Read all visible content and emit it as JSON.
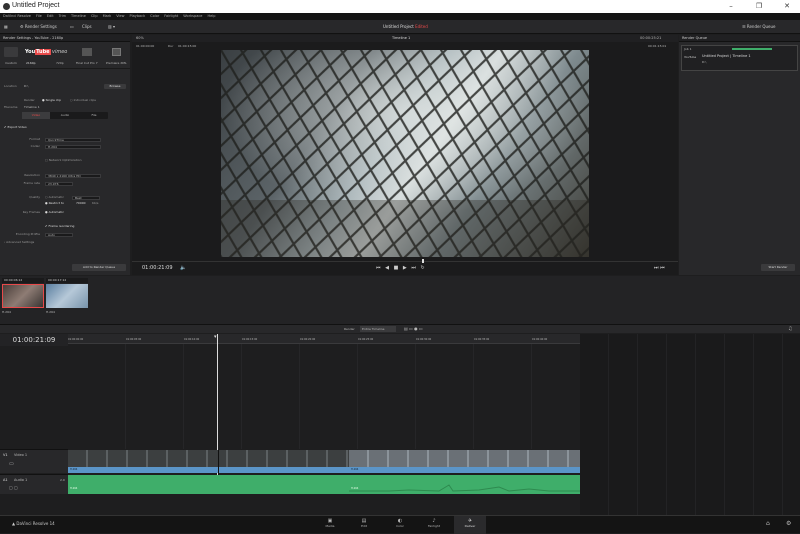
{
  "window": {
    "title": "Untitled Project"
  },
  "menu": [
    "DaVinci Resolve",
    "File",
    "Edit",
    "Trim",
    "Timeline",
    "Clip",
    "Mark",
    "View",
    "Playback",
    "Color",
    "Fairlight",
    "Workspace",
    "Help"
  ],
  "topbar": {
    "render_settings": "Render Settings",
    "clips": "Clips",
    "project_title": "Untitled Project",
    "project_status": "Edited",
    "render_queue": "Render Queue"
  },
  "left": {
    "header": "Render Settings - YouTube - 2160p",
    "presets": [
      {
        "name": "Custom"
      },
      {
        "name": "2160p"
      },
      {
        "name": "720p"
      },
      {
        "name": "Final Cut Pro 7"
      },
      {
        "name": "Premiere XML"
      }
    ],
    "filename_label": "Filename",
    "filename": "Timeline 1",
    "location_label": "Location",
    "location": "D:\\",
    "browse": "Browse",
    "render_label": "Render",
    "single_clip": "Single clip",
    "individual_clips": "Individual clips",
    "tabs": [
      "Video",
      "Audio",
      "File"
    ],
    "export_video": "Export Video",
    "format_label": "Format",
    "format": "QuickTime",
    "codec_label": "Codec",
    "codec": "H.264",
    "network_opt": "Network Optimization",
    "resolution_label": "Resolution",
    "resolution": "3840 x 2160 Ultra HD",
    "framerate_label": "Frame rate",
    "framerate": "23.976",
    "quality_label": "Quality",
    "quality_auto": "Automatic",
    "quality_best": "Best",
    "restrict_to": "Restrict to",
    "restrict_value": "70000",
    "restrict_unit": "Kb/s",
    "keyframes_label": "Key Frames",
    "kf_auto": "Automatic",
    "frame_reorder": "Frame reordering",
    "encoding_label": "Encoding Profile",
    "encoding": "Auto",
    "advanced": "Advanced Settings",
    "add_queue": "Add to Render Queue"
  },
  "viewer": {
    "zoom": "60%",
    "tc_left": "01:00:00:00",
    "in_label": "Dur",
    "in_tc": "01:00:15:00",
    "timeline_name": "Timeline 1",
    "tc_right": "00:00:25:21",
    "out_tc": "00:01:15:01",
    "current_tc": "01:00:21:09"
  },
  "render_queue": {
    "header": "Render Queue",
    "job": "Job 1",
    "job_title": "Untitled Project | Timeline 1",
    "job_sub": "YouTube",
    "job_detail": "D:\\",
    "start": "Start Render"
  },
  "clips": [
    {
      "tc": "00:00:06:12",
      "codec": "H.264"
    },
    {
      "tc": "00:00:17:12",
      "codec": "H.264"
    }
  ],
  "timeline": {
    "tc": "01:00:21:09",
    "render_label": "Render",
    "render_value": "Entire Timeline",
    "ruler": [
      "01:00:00:00",
      "01:00:05:00",
      "01:00:10:00",
      "01:00:15:00",
      "01:00:20:00",
      "01:00:25:00",
      "01:00:30:00",
      "01:00:35:00",
      "01:00:40:00"
    ],
    "v1": "V1",
    "video_track": "Video 1",
    "a1": "A1",
    "audio_track": "Audio 1",
    "audio_ch": "2.0",
    "clipnames": [
      "H.264",
      "H.264",
      "H.264",
      "H.264"
    ]
  },
  "bottom": {
    "app": "DaVinci Resolve 14",
    "pages": [
      "Media",
      "Edit",
      "Color",
      "Fairlight",
      "Deliver"
    ],
    "active": "Deliver"
  },
  "colors": {
    "accent": "#e84a4a",
    "video_clip": "#5b95c8",
    "audio_clip": "#3fae6a",
    "active_tab": "#3c3c3e"
  }
}
